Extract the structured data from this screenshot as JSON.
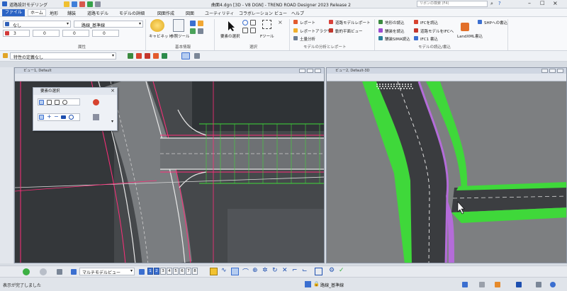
{
  "titlebar": {
    "app_name": "道路設計モデリング",
    "window_title": "曲面4.dgn [3D - V8 DGN] - TREND ROAD Designer 2023 Release 2",
    "search_placeholder": "リボンの検索 (F4)"
  },
  "menubar": {
    "items": [
      "ファイル",
      "ホーム",
      "地形",
      "舗装",
      "道路モデル",
      "モデルの詳細",
      "図面作成",
      "図面",
      "ユーティリティ",
      "コラボレーション",
      "ビュー",
      "ヘルプ"
    ],
    "active_index": 1
  },
  "ribbon": {
    "attributes": {
      "group_label": "属性",
      "level_value": "なし",
      "style_value": "路線_基準線",
      "color_value": "3",
      "weight_value": "0",
      "linestyle_value": "0",
      "transparency_value": "0"
    },
    "basic_info": {
      "group_label": "基本情報",
      "label_capnet": "キャビネット",
      "label_reference": "参照ツール"
    },
    "select": {
      "group_label": "選択",
      "label_element_select": "要素の選択",
      "label_fence": "Fツール"
    },
    "model_analysis": {
      "group_label": "モデルの分析とレポート",
      "items": [
        "レポート",
        "道路モデルレポート",
        "レポートアラクザ",
        "動的平面ビュー",
        "土量分析"
      ]
    },
    "model_io": {
      "group_label": "モデルの読込/書込",
      "items": [
        "地形の読込",
        "IFCを読込",
        "SHPへの書込",
        "舗装を読込",
        "道路モデルをIFCへ",
        "LandXML書込",
        "舗装SIMA読込",
        "IFC1 書込"
      ]
    }
  },
  "strip": {
    "definition_value": "特性の定義なし"
  },
  "view_left": {
    "title": "ビュー1, Default"
  },
  "view_right": {
    "title": "ビュー2, Default-3D"
  },
  "element_dialog": {
    "title": "要素の選択"
  },
  "bottombar": {
    "view_dropdown": "マルチモデルビュー",
    "view_numbers": [
      "1",
      "2",
      "3",
      "4",
      "5",
      "6",
      "7",
      "8"
    ],
    "active_views": [
      "1",
      "2"
    ]
  },
  "statusbar": {
    "message": "表示が完了しました",
    "level_display": "路線_基準線"
  },
  "colors": {
    "accent": "#2b63c4",
    "road_green": "#3fd83a",
    "alignment_magenta": "#ff2e7a"
  }
}
